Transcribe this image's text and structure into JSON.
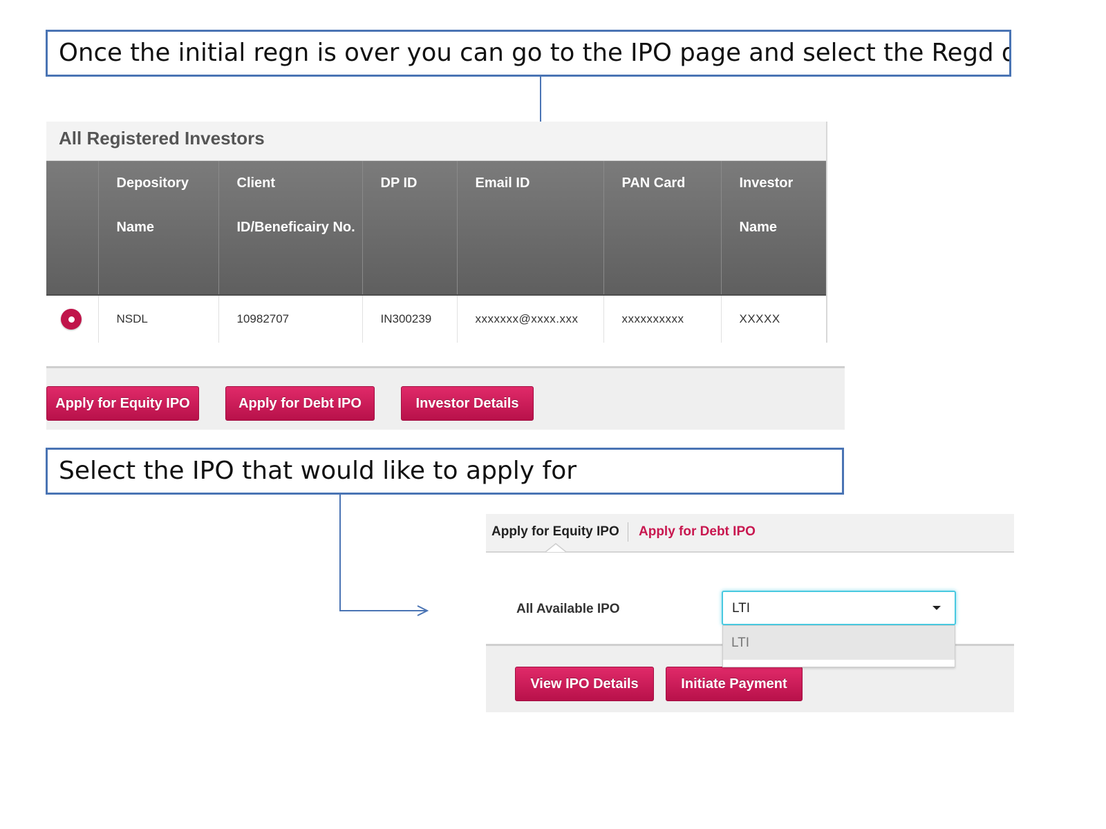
{
  "callouts": {
    "top": "Once the initial regn is over you can go to the IPO page and select the Regd details",
    "bottom": "Select the IPO that would like to apply for"
  },
  "investors_panel": {
    "title": "All Registered Investors",
    "columns": [
      "",
      "Depository Name",
      "Client ID/Beneficairy No.",
      "DP ID",
      "Email ID",
      "PAN Card",
      "Investor Name"
    ],
    "rows": [
      {
        "selected": true,
        "depository": "NSDL",
        "client_id": "10982707",
        "dp_id": "IN300239",
        "email": "xxxxxxx@xxxx.xxx",
        "pan": "xxxxxxxxxx",
        "investor_name": "XXXXX"
      }
    ]
  },
  "actions": {
    "equity": "Apply for Equity IPO",
    "debt": "Apply for Debt IPO",
    "investor_details": "Investor Details"
  },
  "ipo_panel": {
    "tabs": [
      "Apply for Equity IPO",
      "Apply for Debt IPO"
    ],
    "active_tab": "Apply for Equity IPO",
    "select_label": "All Available IPO",
    "select_value": "LTI",
    "options": [
      "LTI"
    ],
    "view_button": "View IPO Details",
    "pay_button": "Initiate Payment"
  },
  "colors": {
    "accent": "#c8174f",
    "callout_border": "#4a74b4",
    "header_bg": "#6b6b6b",
    "focus": "#49c9e0"
  },
  "icons": {
    "radio": "radio-selected-icon",
    "caret": "caret-down-icon",
    "arrow": "arrow-icon"
  }
}
